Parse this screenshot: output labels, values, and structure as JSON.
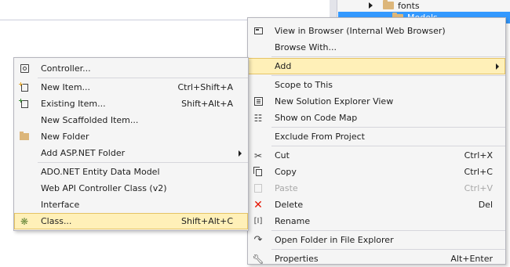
{
  "explorer": {
    "items": [
      {
        "label": "fonts"
      },
      {
        "label": "Models"
      }
    ]
  },
  "main_menu": {
    "items": [
      {
        "label": "View in Browser (Internal Web Browser)",
        "shortcut": ""
      },
      {
        "label": "Browse With...",
        "shortcut": ""
      },
      {
        "label": "Add",
        "shortcut": ""
      },
      {
        "label": "Scope to This",
        "shortcut": ""
      },
      {
        "label": "New Solution Explorer View",
        "shortcut": ""
      },
      {
        "label": "Show on Code Map",
        "shortcut": ""
      },
      {
        "label": "Exclude From Project",
        "shortcut": ""
      },
      {
        "label": "Cut",
        "shortcut": "Ctrl+X"
      },
      {
        "label": "Copy",
        "shortcut": "Ctrl+C"
      },
      {
        "label": "Paste",
        "shortcut": "Ctrl+V"
      },
      {
        "label": "Delete",
        "shortcut": "Del"
      },
      {
        "label": "Rename",
        "shortcut": ""
      },
      {
        "label": "Open Folder in File Explorer",
        "shortcut": ""
      },
      {
        "label": "Properties",
        "shortcut": "Alt+Enter"
      }
    ]
  },
  "add_submenu": {
    "items": [
      {
        "label": "Controller...",
        "shortcut": ""
      },
      {
        "label": "New Item...",
        "shortcut": "Ctrl+Shift+A"
      },
      {
        "label": "Existing Item...",
        "shortcut": "Shift+Alt+A"
      },
      {
        "label": "New Scaffolded Item...",
        "shortcut": ""
      },
      {
        "label": "New Folder",
        "shortcut": ""
      },
      {
        "label": "Add ASP.NET Folder",
        "shortcut": ""
      },
      {
        "label": "ADO.NET Entity Data Model",
        "shortcut": ""
      },
      {
        "label": "Web API Controller Class (v2)",
        "shortcut": ""
      },
      {
        "label": "Interface",
        "shortcut": ""
      },
      {
        "label": "Class...",
        "shortcut": "Shift+Alt+C"
      }
    ]
  },
  "colors": {
    "menu_bg": "#f5f5f5",
    "highlight": "#fff0b8",
    "selection": "#3399ff",
    "disabled_text": "#a8a8a8"
  }
}
